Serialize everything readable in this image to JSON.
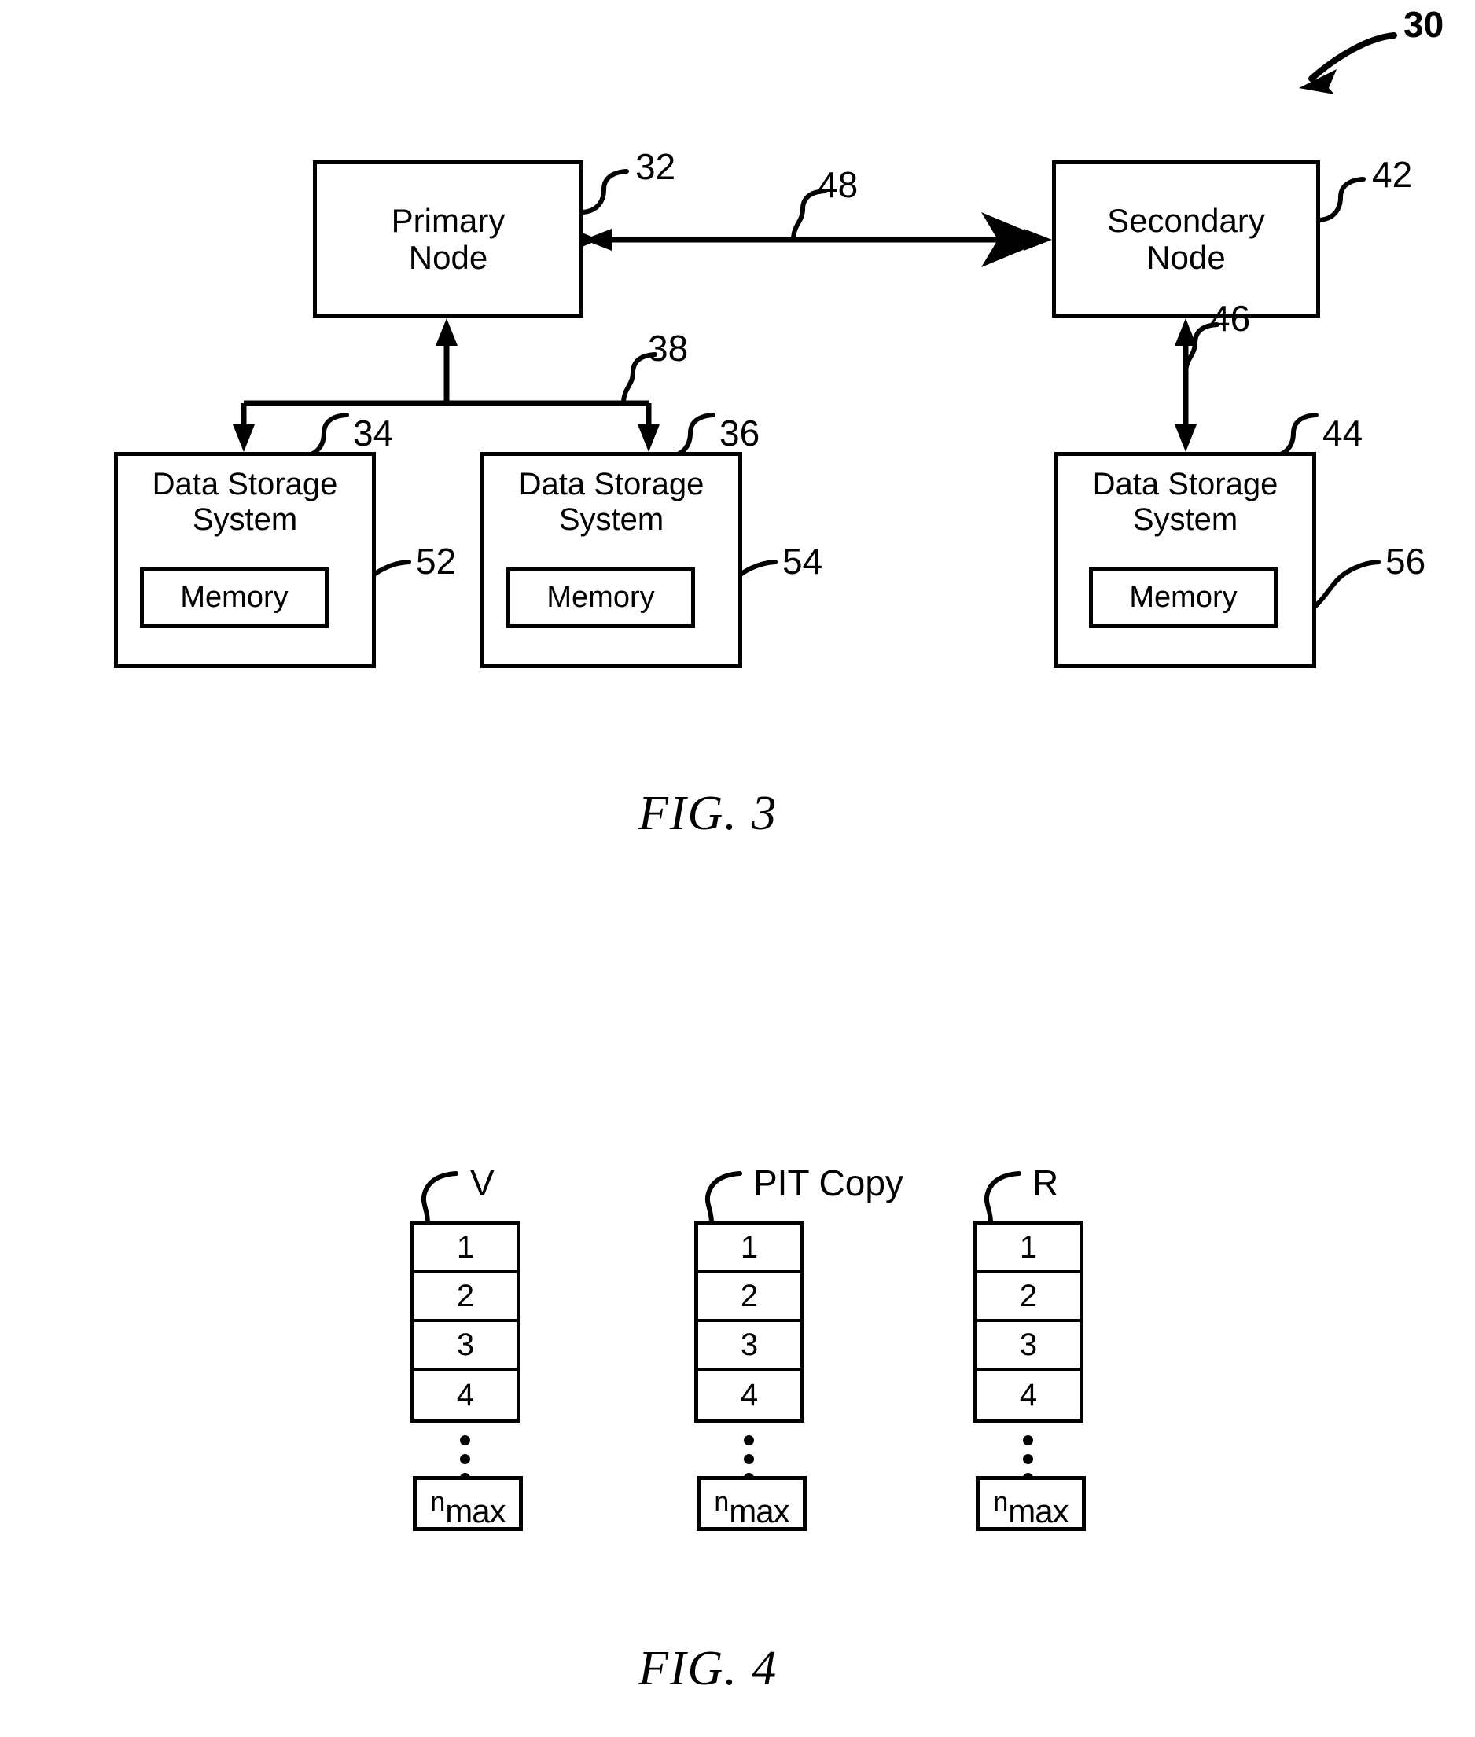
{
  "figure3": {
    "overall_ref": "30",
    "nodes": [
      {
        "label_line1": "Primary",
        "label_line2": "Node",
        "ref": "32"
      },
      {
        "label_line1": "Secondary",
        "label_line2": "Node",
        "ref": "42"
      }
    ],
    "storage_systems": [
      {
        "title_line1": "Data Storage",
        "title_line2": "System",
        "ref": "34",
        "memory_label": "Memory",
        "memory_ref": "52"
      },
      {
        "title_line1": "Data Storage",
        "title_line2": "System",
        "ref": "36",
        "memory_label": "Memory",
        "memory_ref": "54"
      },
      {
        "title_line1": "Data Storage",
        "title_line2": "System",
        "ref": "44",
        "memory_label": "Memory",
        "memory_ref": "56"
      }
    ],
    "connections": [
      {
        "ref": "48",
        "kind": "bidirectional-horizontal",
        "from": "Primary Node",
        "to": "Secondary Node"
      },
      {
        "ref": "38",
        "kind": "bus-to-storage",
        "from": "Primary Node",
        "to": "Data Storage System 34 / 36"
      },
      {
        "ref": "46",
        "kind": "bidirectional-vertical",
        "from": "Secondary Node",
        "to": "Data Storage System 44"
      }
    ],
    "caption": "FIG.  3"
  },
  "figure4": {
    "tables": [
      {
        "head": "V",
        "rows": [
          "1",
          "2",
          "3",
          "4"
        ],
        "last_row_n": "n",
        "last_row_sub": "max"
      },
      {
        "head": "PIT Copy",
        "rows": [
          "1",
          "2",
          "3",
          "4"
        ],
        "last_row_n": "n",
        "last_row_sub": "max"
      },
      {
        "head": "R",
        "rows": [
          "1",
          "2",
          "3",
          "4"
        ],
        "last_row_n": "n",
        "last_row_sub": "max"
      }
    ],
    "caption": "FIG.  4"
  },
  "colors": {
    "ink": "#000000",
    "paper": "#ffffff"
  }
}
